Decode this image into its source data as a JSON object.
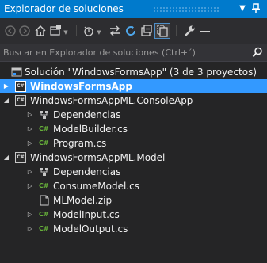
{
  "panel": {
    "title": "Explorador de soluciones",
    "pin_icon": "pin-icon",
    "dropdown_icon": "chevron-down-icon"
  },
  "toolbar": {
    "items": [
      {
        "name": "back-icon",
        "glyph": "⊝"
      },
      {
        "name": "forward-icon",
        "glyph": "⊝"
      },
      {
        "name": "home-icon",
        "glyph": "⌂"
      },
      {
        "name": "switch-views-icon",
        "glyph": "▦"
      },
      {
        "name": "pending-changes-icon",
        "glyph": "◷"
      },
      {
        "name": "sync-icon",
        "glyph": "⇆"
      },
      {
        "name": "refresh-icon",
        "glyph": "↻"
      },
      {
        "name": "collapse-all-icon",
        "glyph": "▣"
      },
      {
        "name": "show-all-files-icon",
        "glyph": "▤"
      },
      {
        "name": "properties-icon",
        "glyph": "🔧"
      },
      {
        "name": "preview-icon",
        "glyph": "−"
      }
    ]
  },
  "search": {
    "placeholder": "Buscar en Explorador de soluciones (Ctrl+´)",
    "value": ""
  },
  "tree": {
    "solution_label": "Solución \"WindowsFormsApp\" (3 de 3 proyectos)",
    "project1": "WindowsFormsApp",
    "project2": "WindowsFormsAppML.ConsoleApp",
    "p2_deps": "Dependencias",
    "p2_file1": "ModelBuilder.cs",
    "p2_file2": "Program.cs",
    "project3": "WindowsFormsAppML.Model",
    "p3_deps": "Dependencias",
    "p3_file1": "ConsumeModel.cs",
    "p3_file2": "MLModel.zip",
    "p3_file3": "ModelInput.cs",
    "p3_file4": "ModelOutput.cs",
    "cs_badge": "C#"
  },
  "colors": {
    "accent": "#007acc",
    "selection": "#3399ff",
    "background": "#252526",
    "csharp_green": "#68b33a"
  }
}
